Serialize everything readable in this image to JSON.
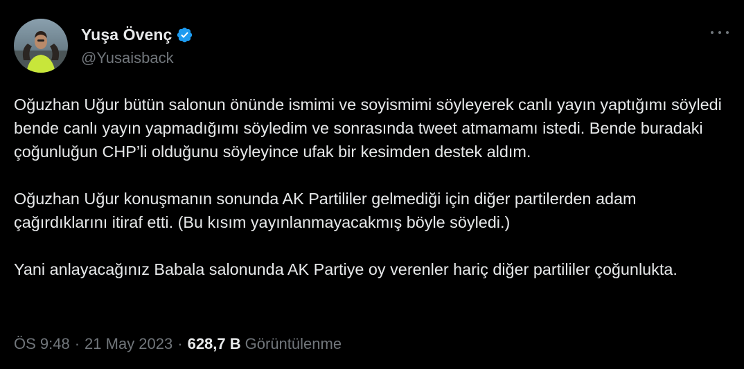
{
  "author": {
    "display_name": "Yuşa Övenç",
    "handle": "@Yusaisback",
    "verified": true
  },
  "tweet": {
    "paragraphs": [
      "Oğuzhan Uğur bütün salonun önünde ismimi ve soyismimi söyleyerek canlı yayın yaptığımı söyledi bende canlı yayın yapmadığımı söyledim ve sonrasında tweet atmamamı istedi. Bende buradaki çoğunluğun CHP’li olduğunu söyleyince ufak bir kesimden destek aldım.",
      "Oğuzhan Uğur konuşmanın sonunda AK Partililer gelmediği için diğer partilerden adam çağırdıklarını itiraf etti. (Bu kısım yayınlanmayacakmış böyle söyledi.)",
      "Yani anlayacağınız Babala salonunda AK Partiye oy verenler hariç diğer partililer çoğunlukta."
    ]
  },
  "meta": {
    "time": "ÖS 9:48",
    "separator": "·",
    "date": "21 May 2023",
    "views_count": "628,7 B",
    "views_label": "Görüntülenme"
  },
  "colors": {
    "background": "#000000",
    "text": "#e7e9ea",
    "secondary": "#71767b",
    "verified_blue": "#1d9bf0"
  },
  "icons": {
    "verified": "verified-badge-icon",
    "more": "more-horizontal-icon"
  }
}
